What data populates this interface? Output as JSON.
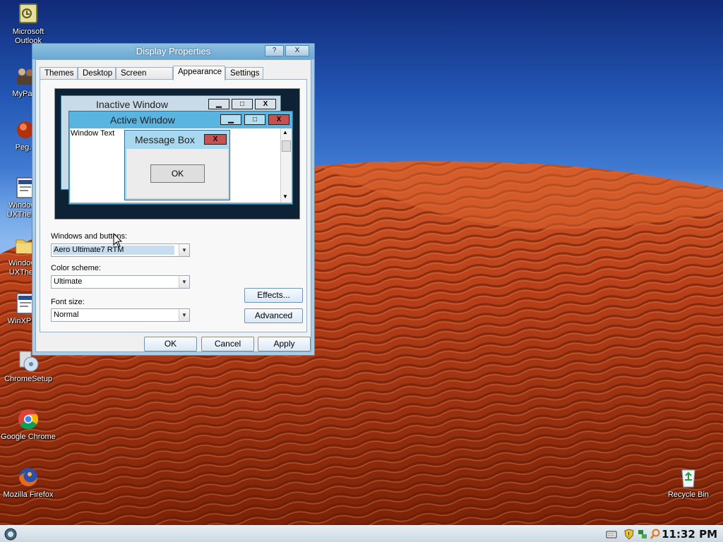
{
  "desktop": {
    "icons": [
      {
        "name": "Microsoft Outlook",
        "icon": "outlook-icon"
      },
      {
        "name": "MyPa...",
        "icon": "user-folder-icon"
      },
      {
        "name": "Peg...",
        "icon": "pegasus-icon"
      },
      {
        "name": "Window... UXThem...",
        "icon": "uxtheme-window-icon"
      },
      {
        "name": "Window... UXTher...",
        "icon": "folder-icon"
      },
      {
        "name": "WinXPR...",
        "icon": "winxp-window-icon"
      },
      {
        "name": "ChromeSetup",
        "icon": "chrome-setup-icon"
      },
      {
        "name": "Google Chrome",
        "icon": "chrome-icon"
      },
      {
        "name": "Mozilla Firefox",
        "icon": "firefox-icon"
      },
      {
        "name": "Recycle Bin",
        "icon": "recycle-bin-icon"
      }
    ]
  },
  "dialog": {
    "title": "Display Properties",
    "help_glyph": "?",
    "close_glyph": "X",
    "tabs": [
      {
        "label": "Themes"
      },
      {
        "label": "Desktop"
      },
      {
        "label": "Screen Saver"
      },
      {
        "label": "Appearance",
        "active": true
      },
      {
        "label": "Settings"
      }
    ],
    "preview": {
      "inactive_title": "Inactive Window",
      "active_title": "Active Window",
      "window_text": "Window Text",
      "message_box_title": "Message Box",
      "message_box_ok": "OK",
      "min_glyph": "▁",
      "max_glyph": "□",
      "close_glyph": "X"
    },
    "windows_buttons_label": "Windows and buttons:",
    "windows_buttons_value": "Aero Ultimate7 RTM",
    "color_scheme_label": "Color scheme:",
    "color_scheme_value": "Ultimate",
    "font_size_label": "Font size:",
    "font_size_value": "Normal",
    "effects_label": "Effects...",
    "advanced_label": "Advanced",
    "ok_label": "OK",
    "cancel_label": "Cancel",
    "apply_label": "Apply"
  },
  "taskbar": {
    "start_icon": "start-orb-icon",
    "tray_icons": [
      "keyboard-icon",
      "security-shield-icon",
      "network-icon",
      "search-icon"
    ],
    "clock": "11:32 PM"
  },
  "colors": {
    "sky_top": "#102a78",
    "sky_bottom": "#8bb8ee",
    "sand": "#b8401a",
    "dialog_frame": "#a9cde6",
    "preview_bg": "#0d2235",
    "close_red": "#c75050"
  }
}
